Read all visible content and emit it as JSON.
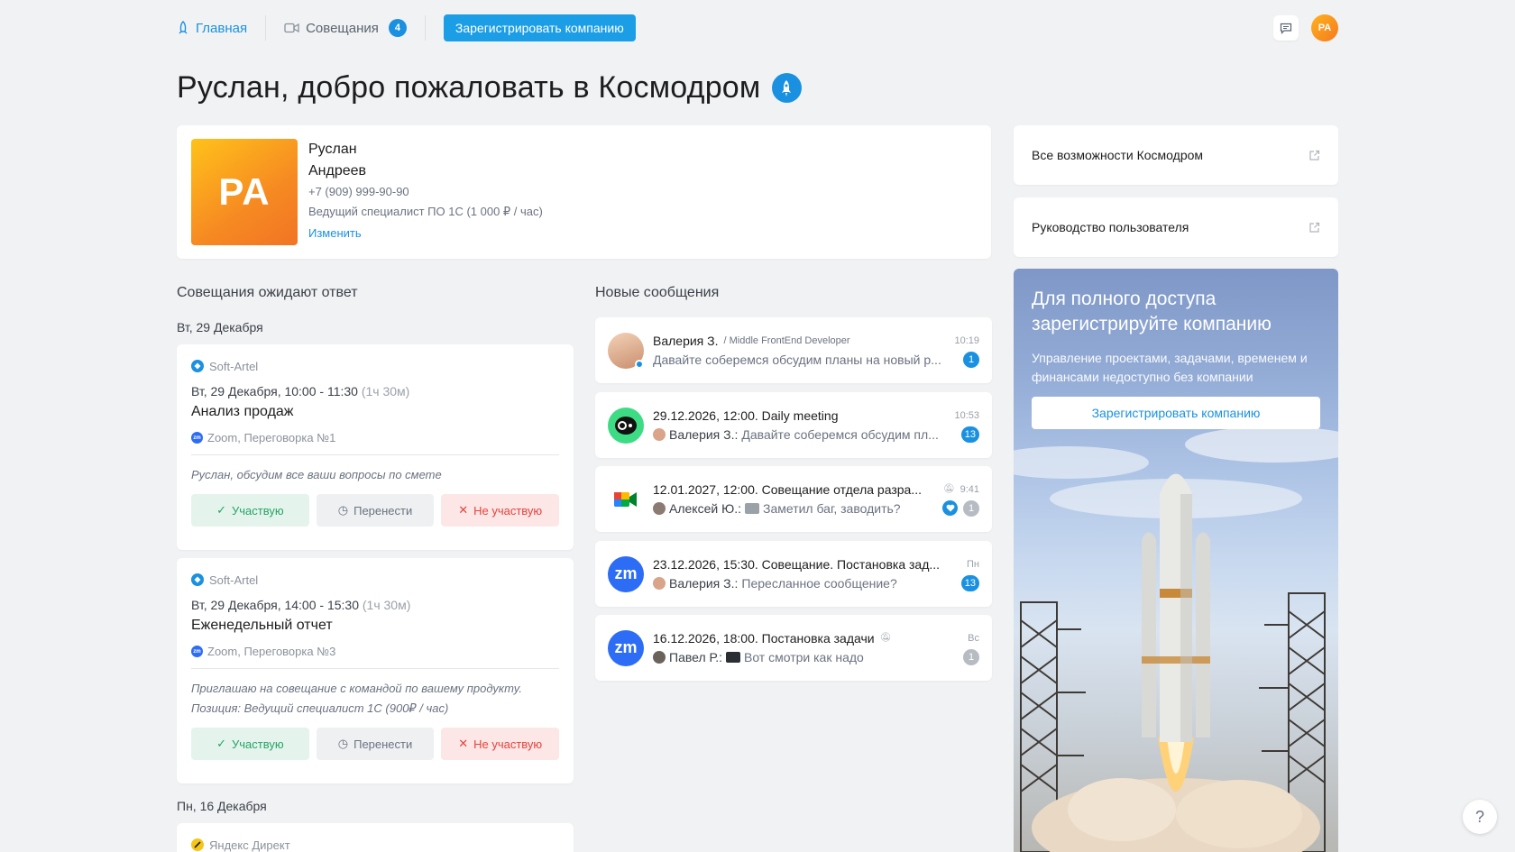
{
  "nav": {
    "home": "Главная",
    "meetings": "Совещания",
    "meetings_count": "4",
    "register": "Зарегистрировать компанию",
    "user_initials": "PA"
  },
  "welcome": "Руслан, добро пожаловать в Космодром",
  "profile": {
    "initials": "PA",
    "first_name": "Руслан",
    "last_name": "Андреев",
    "phone": "+7 (909) 999-90-90",
    "position": "Ведущий специалист ПО 1С (1 000 ₽ / час)",
    "edit": "Изменить"
  },
  "meetings_section": {
    "title": "Совещания ожидают ответ",
    "date1": "Вт, 29 Декабря",
    "date2": "Пн, 16 Декабря",
    "buttons": {
      "yes": "Участвую",
      "move": "Перенести",
      "no": "Не участвую"
    },
    "items": [
      {
        "org": "Soft-Artel",
        "time": "Вт, 29 Декабря, 10:00 - 11:30",
        "duration": "(1ч 30м)",
        "title": "Анализ продаж",
        "place": "Zoom, Переговорка №1",
        "note": "Руслан, обсудим все ваши вопросы по смете"
      },
      {
        "org": "Soft-Artel",
        "time": "Вт, 29 Декабря, 14:00 - 15:30",
        "duration": "(1ч 30м)",
        "title": "Еженедельный отчет",
        "place": "Zoom, Переговорка №3",
        "note": "Приглашаю на совещание с командой по вашему продукту. Позиция: Ведущий специалист 1С (900₽ / час)"
      },
      {
        "org": "Яндекс Директ"
      }
    ]
  },
  "messages_section": {
    "title": "Новые сообщения",
    "items": [
      {
        "title": "Валерия З.",
        "role": "/ Middle FrontEnd Developer",
        "time": "10:19",
        "sender": "",
        "text": "Давайте соберемся обсудим планы на новый р...",
        "count": "1"
      },
      {
        "title": "29.12.2026, 12:00. Daily meeting",
        "time": "10:53",
        "sender": "Валерия З.:",
        "text": "Давайте соберемся обсудим пл...",
        "count": "13"
      },
      {
        "title": "12.01.2027, 12:00. Совещание отдела разра...",
        "time": "9:41",
        "sender": "Алексей Ю.:",
        "text": "Заметил баг, заводить?",
        "count": "1"
      },
      {
        "title": "23.12.2026, 15:30. Совещание. Постановка зад...",
        "time": "Пн",
        "sender": "Валерия З.:",
        "text": "Пересланное сообщение?",
        "count": "13"
      },
      {
        "title": "16.12.2026, 18:00. Постановка задачи",
        "time": "Вс",
        "sender": "Павел Р.:",
        "text": "Вот смотри как надо",
        "count": "1"
      }
    ]
  },
  "right": {
    "link1": "Все возможности Космодром",
    "link2": "Руководство пользователя",
    "promo_title": "Для полного доступа зарегистрируйте компанию",
    "promo_sub": "Управление проектами, задачами, временем и финансами недоступно без компании",
    "promo_btn": "Зарегистрировать компанию"
  },
  "help": "?"
}
